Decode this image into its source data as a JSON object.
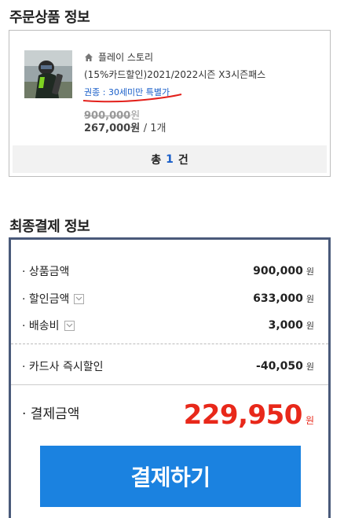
{
  "order_section": {
    "title": "주문상품 정보",
    "shop_name": "플레이 스토리",
    "product_name": "(15%카드할인)2021/2022시즌 X3시즌패스",
    "ticket_type": "권종 : 30세미만 특별가",
    "original_price": "900,000",
    "original_price_unit": "원",
    "sale_price": "267,000원",
    "quantity": "/ 1개",
    "total_prefix": "총",
    "total_count": "1",
    "total_suffix": "건"
  },
  "payment_section": {
    "title": "최종결제 정보",
    "rows": [
      {
        "label": "· 상품금액",
        "value": "900,000",
        "unit": "원"
      },
      {
        "label": "· 할인금액",
        "value": "633,000",
        "unit": "원"
      },
      {
        "label": "· 배송비",
        "value": "3,000",
        "unit": "원"
      },
      {
        "label": "· 카드사 즉시할인",
        "value": "-40,050",
        "unit": "원"
      }
    ],
    "final_label": "· 결제금액",
    "final_amount": "229,950",
    "final_unit": "원",
    "pay_button_label": "결제하기"
  },
  "colors": {
    "accent_blue": "#1b82e0",
    "link_blue": "#1a5fc9",
    "price_red": "#e8281a",
    "pay_border": "#4a5a7a"
  },
  "icons": {
    "shop": "home-icon",
    "expand": "chevron-down-icon"
  }
}
